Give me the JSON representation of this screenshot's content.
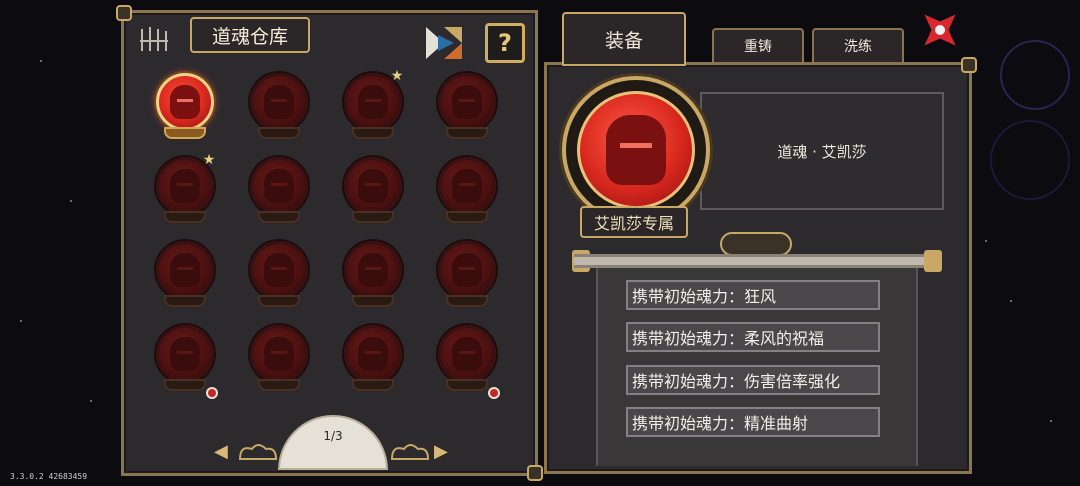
{
  "version_text": "3.3.0.2 42683459",
  "warehouse": {
    "title": "道魂仓库",
    "swap_icon": "swap-icon",
    "help_label": "?",
    "pager": "1/3",
    "slots": [
      {
        "active": true,
        "star": false,
        "badge": false
      },
      {
        "active": false,
        "star": false,
        "badge": false
      },
      {
        "active": false,
        "star": true,
        "badge": false
      },
      {
        "active": false,
        "star": false,
        "badge": false
      },
      {
        "active": false,
        "star": true,
        "badge": false
      },
      {
        "active": false,
        "star": false,
        "badge": false
      },
      {
        "active": false,
        "star": false,
        "badge": false
      },
      {
        "active": false,
        "star": false,
        "badge": false
      },
      {
        "active": false,
        "star": false,
        "badge": false
      },
      {
        "active": false,
        "star": false,
        "badge": false
      },
      {
        "active": false,
        "star": false,
        "badge": false
      },
      {
        "active": false,
        "star": false,
        "badge": false
      },
      {
        "active": false,
        "star": false,
        "badge": true
      },
      {
        "active": false,
        "star": false,
        "badge": false
      },
      {
        "active": false,
        "star": false,
        "badge": false
      },
      {
        "active": false,
        "star": false,
        "badge": true
      }
    ]
  },
  "tabs": {
    "equip": "装备",
    "recast": "重铸",
    "refine": "洗练"
  },
  "detail": {
    "name": "道魂 · 艾凯莎",
    "exclusive": "艾凯莎专属",
    "perks": [
      "携带初始魂力：狂风",
      "携带初始魂力：柔风的祝福",
      "携带初始魂力：伤害倍率强化",
      "携带初始魂力：精准曲射"
    ]
  },
  "colors": {
    "gold": "#c9a866",
    "orb_active": "#d8281e",
    "orb_inactive": "#4a1010",
    "close_red": "#d8282e"
  }
}
